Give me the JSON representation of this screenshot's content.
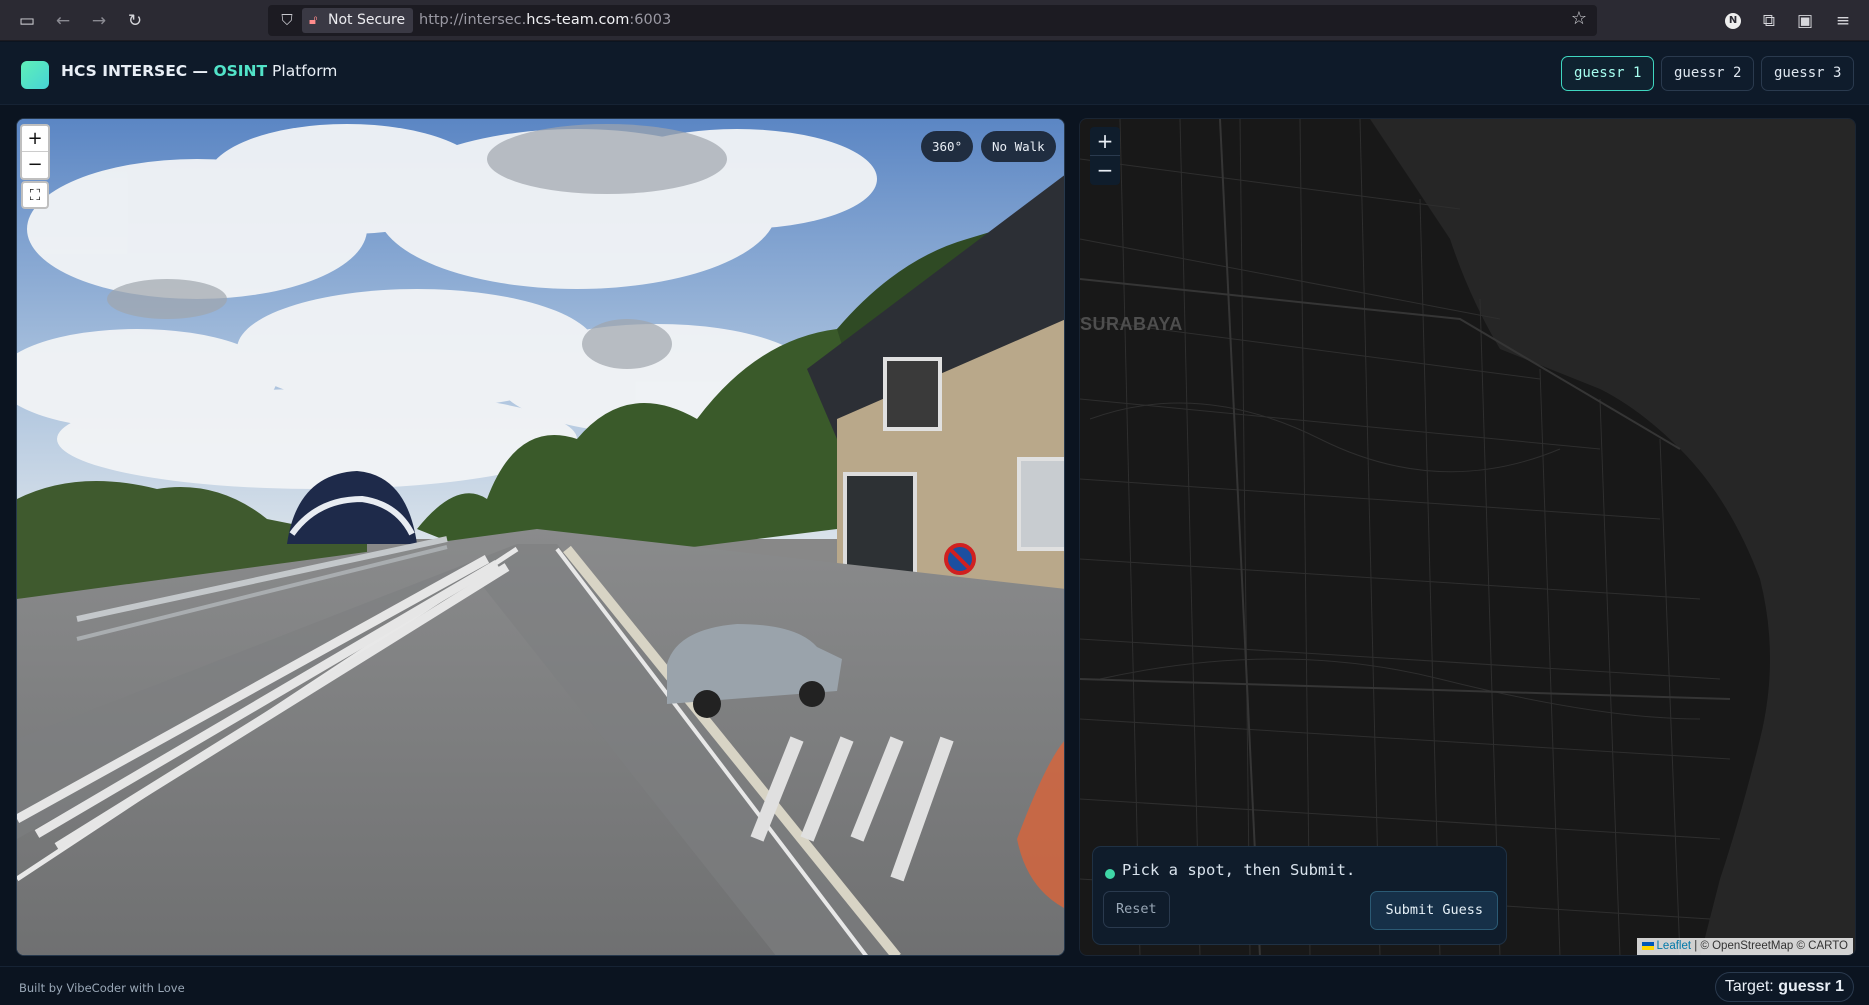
{
  "browser": {
    "security_label": "Not Secure",
    "url_prefix": "http://intersec.",
    "url_host": "hcs-team.com",
    "url_suffix": ":6003"
  },
  "header": {
    "brand": "HCS INTERSEC — ",
    "brand_accent": "OSINT",
    "brand_suffix": " Platform",
    "tabs": [
      {
        "label": "guessr 1",
        "active": true
      },
      {
        "label": "guessr 2",
        "active": false
      },
      {
        "label": "guessr 3",
        "active": false
      }
    ]
  },
  "street_view": {
    "zoom_in": "+",
    "zoom_out": "−",
    "badges": [
      "360°",
      "No Walk"
    ]
  },
  "map": {
    "zoom_in": "+",
    "zoom_out": "−",
    "city_label": "SURABAYA",
    "status": "Pick a spot, then Submit.",
    "reset_label": "Reset",
    "submit_label": "Submit Guess",
    "attribution_link": "Leaflet",
    "attribution_rest": " | © OpenStreetMap © CARTO"
  },
  "footer": {
    "credit": "Built by VibeCoder with Love",
    "target_prefix": "Target: ",
    "target_value": "guessr 1"
  },
  "colors": {
    "accent": "#52e3c8",
    "background": "#0b1420",
    "map_bg": "#1e1e1e"
  }
}
